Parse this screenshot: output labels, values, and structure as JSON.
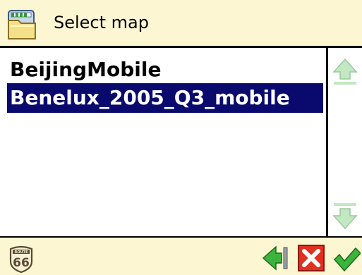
{
  "header": {
    "title": "Select map",
    "icon": "folder-map-icon"
  },
  "maps": [
    {
      "label": "BeijingMobile",
      "selected": false
    },
    {
      "label": "Benelux_2005_Q3_mobile",
      "selected": true
    }
  ],
  "scrollbar": {
    "up_icon": "scroll-up-arrow-icon",
    "down_icon": "scroll-down-arrow-icon"
  },
  "footer": {
    "logo": {
      "text_top": "ROUTE",
      "text_num": "66"
    },
    "back_icon": "back-arrow-icon",
    "cancel_icon": "cancel-x-icon",
    "ok_icon": "ok-checkmark-icon"
  },
  "colors": {
    "header_bg": "#fdf6d3",
    "selection_bg": "#0a0a6e",
    "green": "#3cb43c",
    "red": "#e03020"
  }
}
